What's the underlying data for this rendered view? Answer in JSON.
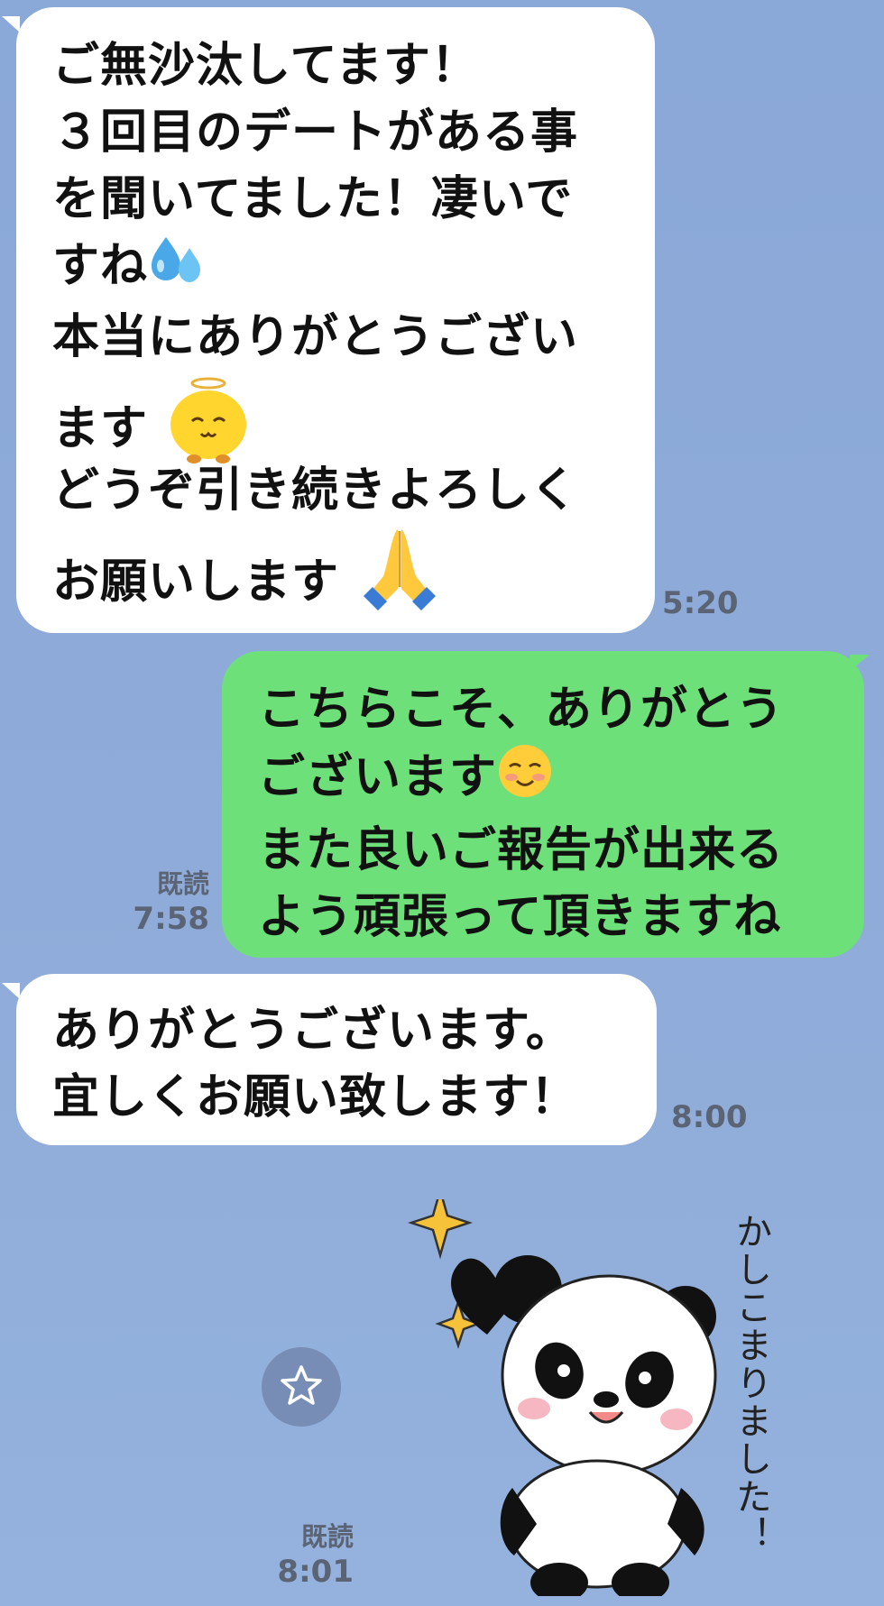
{
  "messages": [
    {
      "lines": [
        "ご無沙汰してます！",
        "３回目のデートがある事",
        "を聞いてました！凄いで",
        "すね",
        "本当にありがとうござい",
        "ます",
        "どうぞ引き続きよろしく",
        "お願いします"
      ],
      "time": "5:20"
    },
    {
      "lines": [
        "こちらこそ、ありがとう",
        "ございます",
        "また良いご報告が出来る",
        "よう頑張って頂きますね"
      ],
      "read": "既読",
      "time": "7:58"
    },
    {
      "lines": [
        "ありがとうございます。",
        "宜しくお願い致します！"
      ],
      "time": "8:00"
    },
    {
      "sticker_text": "かしこまりました！",
      "read": "既読",
      "time": "8:01"
    }
  ],
  "icons": {
    "sweat": "sweat-droplets-icon",
    "chick": "chick-emoji-icon",
    "pray": "folded-hands-icon",
    "smile": "smiling-face-icon",
    "favorite": "star-icon"
  },
  "colors": {
    "background": "#8fabd9",
    "incoming_bubble": "#ffffff",
    "outgoing_bubble": "#6ee07a",
    "meta_text": "#5b6475"
  }
}
